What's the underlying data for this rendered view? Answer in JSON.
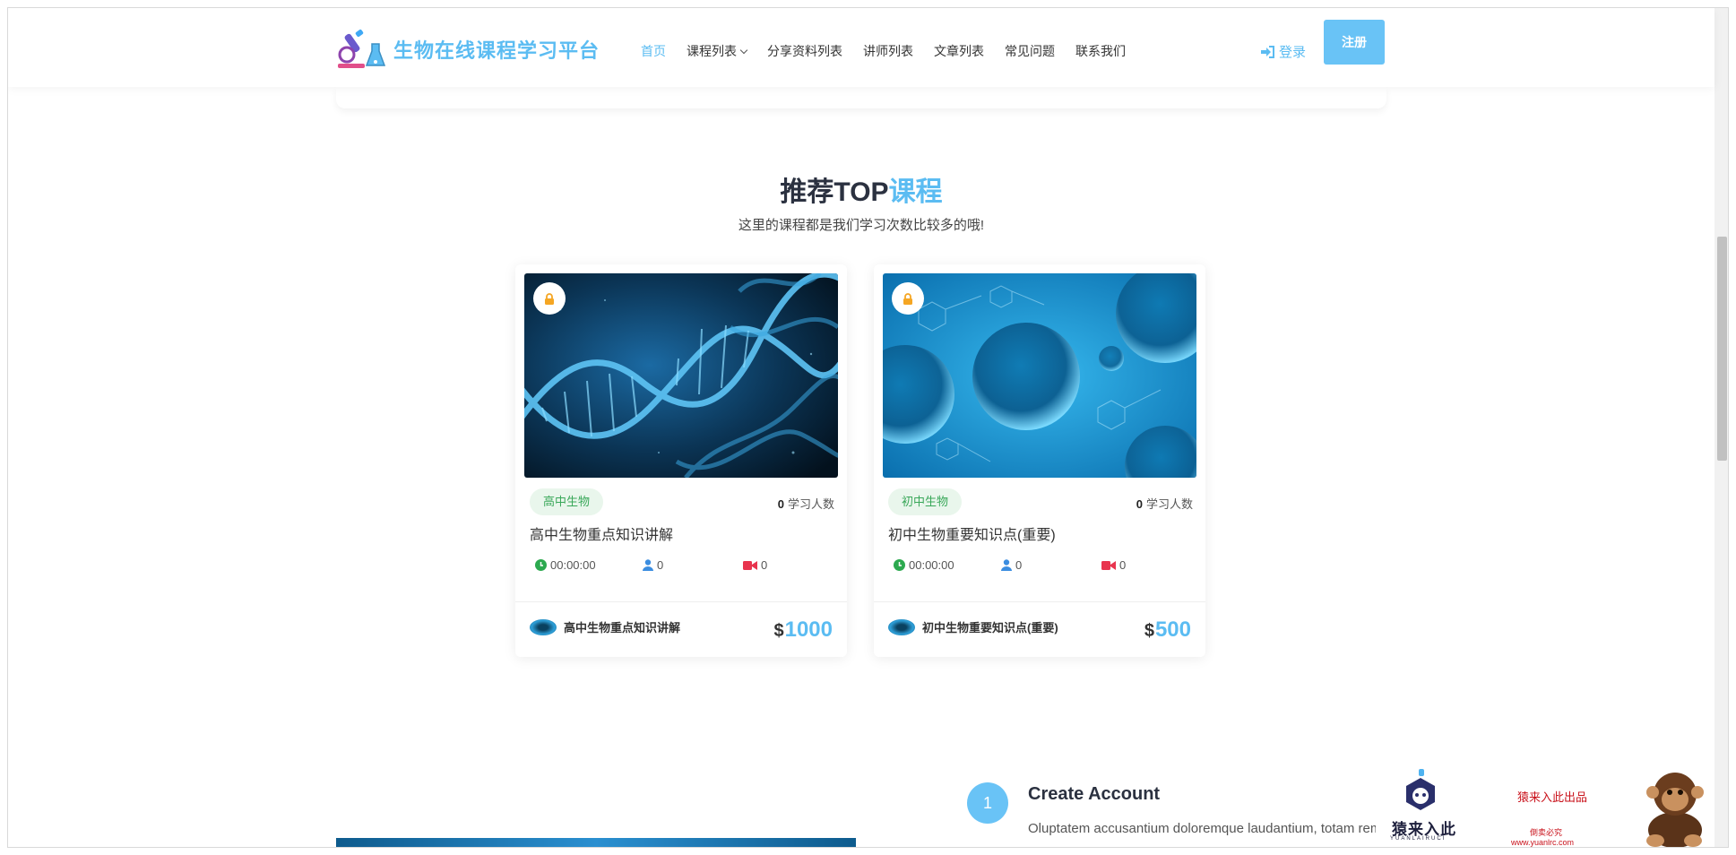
{
  "header": {
    "logo_text": "生物在线课程学习平台",
    "nav": [
      {
        "label": "首页",
        "active": true
      },
      {
        "label": "课程列表",
        "dropdown": true
      },
      {
        "label": "分享资料列表"
      },
      {
        "label": "讲师列表"
      },
      {
        "label": "文章列表"
      },
      {
        "label": "常见问题"
      },
      {
        "label": "联系我们"
      }
    ],
    "login_label": "登录",
    "register_label": "注册"
  },
  "section": {
    "title_main": "推荐TOP",
    "title_accent": "课程",
    "subtitle": "这里的课程都是我们学习次数比较多的哦!"
  },
  "courses": [
    {
      "tag": "高中生物",
      "learners_count": "0",
      "learners_label": "学习人数",
      "title": "高中生物重点知识讲解",
      "duration": "00:00:00",
      "students": "0",
      "videos": "0",
      "teacher": "高中生物重点知识讲解",
      "currency": "$",
      "price": "1000"
    },
    {
      "tag": "初中生物",
      "learners_count": "0",
      "learners_label": "学习人数",
      "title": "初中生物重要知识点(重要)",
      "duration": "00:00:00",
      "students": "0",
      "videos": "0",
      "teacher": "初中生物重要知识点(重要)",
      "currency": "$",
      "price": "500"
    }
  ],
  "step": {
    "number": "1",
    "title": "Create Account",
    "desc": "Oluptatem accusantium doloremque laudantium, totam rem aperiam, eaque ipsa."
  },
  "watermark": {
    "brand": "猿来入此",
    "brand_en": "YUANLAIRUCI",
    "slogan": "猿来入此出品",
    "note": "倒卖必究",
    "url": "www.yuanlrc.com"
  },
  "colors": {
    "accent": "#5bbcf2",
    "tag_bg": "#e9f6ec",
    "tag_text": "#3aa85a"
  }
}
